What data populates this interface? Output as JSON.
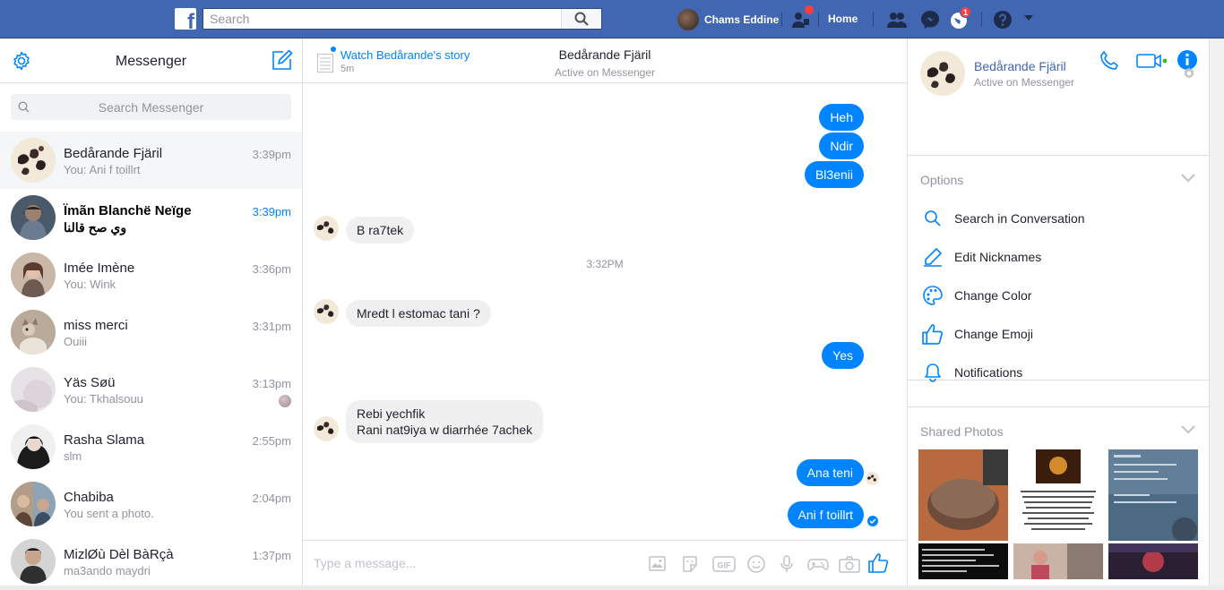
{
  "topbar": {
    "logo": "f",
    "search_placeholder": "Search",
    "user_name": "Chams Eddine",
    "home_label": "Home",
    "notifications_badge": "1"
  },
  "sidebar": {
    "title": "Messenger",
    "search_placeholder": "Search Messenger",
    "conversations": [
      {
        "name": "Bedårande Fjäril",
        "snippet": "You: Ani f toillrt",
        "time": "3:39pm"
      },
      {
        "name": "Ïmãn Blanchë Neïge",
        "snippet": "وي صح قالنا",
        "time": "3:39pm"
      },
      {
        "name": "Imée Imène",
        "snippet": "You: Wink",
        "time": "3:36pm"
      },
      {
        "name": "miss merci",
        "snippet": "Ouiii",
        "time": "3:31pm"
      },
      {
        "name": "Yäs Søü",
        "snippet": "You: Tkhalsouu",
        "time": "3:13pm"
      },
      {
        "name": "Rasha Slama",
        "snippet": "slm",
        "time": "2:55pm"
      },
      {
        "name": "Chabiba",
        "snippet": "You sent a photo.",
        "time": "2:04pm"
      },
      {
        "name": "MizlØù Dèl BàRçà",
        "snippet": "ma3ando maydri",
        "time": "1:37pm"
      }
    ]
  },
  "chat": {
    "story_title": "Watch Bedårande's story",
    "story_time": "5m",
    "peer_name": "Bedårande Fjäril",
    "peer_status": "Active on Messenger",
    "messages": [
      {
        "text": "Heh"
      },
      {
        "text": "Ndir"
      },
      {
        "text": "Bl3enii"
      },
      {
        "text": "B ra7tek"
      },
      {
        "text": "Mredt l estomac tani ?"
      },
      {
        "text": "Yes"
      },
      {
        "text": "Rebi yechfik"
      },
      {
        "text": "Rani nat9iya w diarrhée 7achek"
      },
      {
        "text": "Ana teni"
      },
      {
        "text": "Ani f toillrt"
      }
    ],
    "timestamp_divider": "3:32PM",
    "composer_placeholder": "Type a message..."
  },
  "details": {
    "name": "Bedårande Fjäril",
    "status": "Active on Messenger",
    "options_title": "Options",
    "options": [
      {
        "label": "Search in Conversation",
        "icon": "search-icon"
      },
      {
        "label": "Edit Nicknames",
        "icon": "pencil-icon"
      },
      {
        "label": "Change Color",
        "icon": "palette-icon"
      },
      {
        "label": "Change Emoji",
        "icon": "thumbs-up-icon"
      },
      {
        "label": "Notifications",
        "icon": "bell-icon"
      }
    ],
    "shared_photos_title": "Shared Photos"
  },
  "colors": {
    "brand": "#4267b2",
    "accent": "#0084ff",
    "online": "#42b72a"
  }
}
